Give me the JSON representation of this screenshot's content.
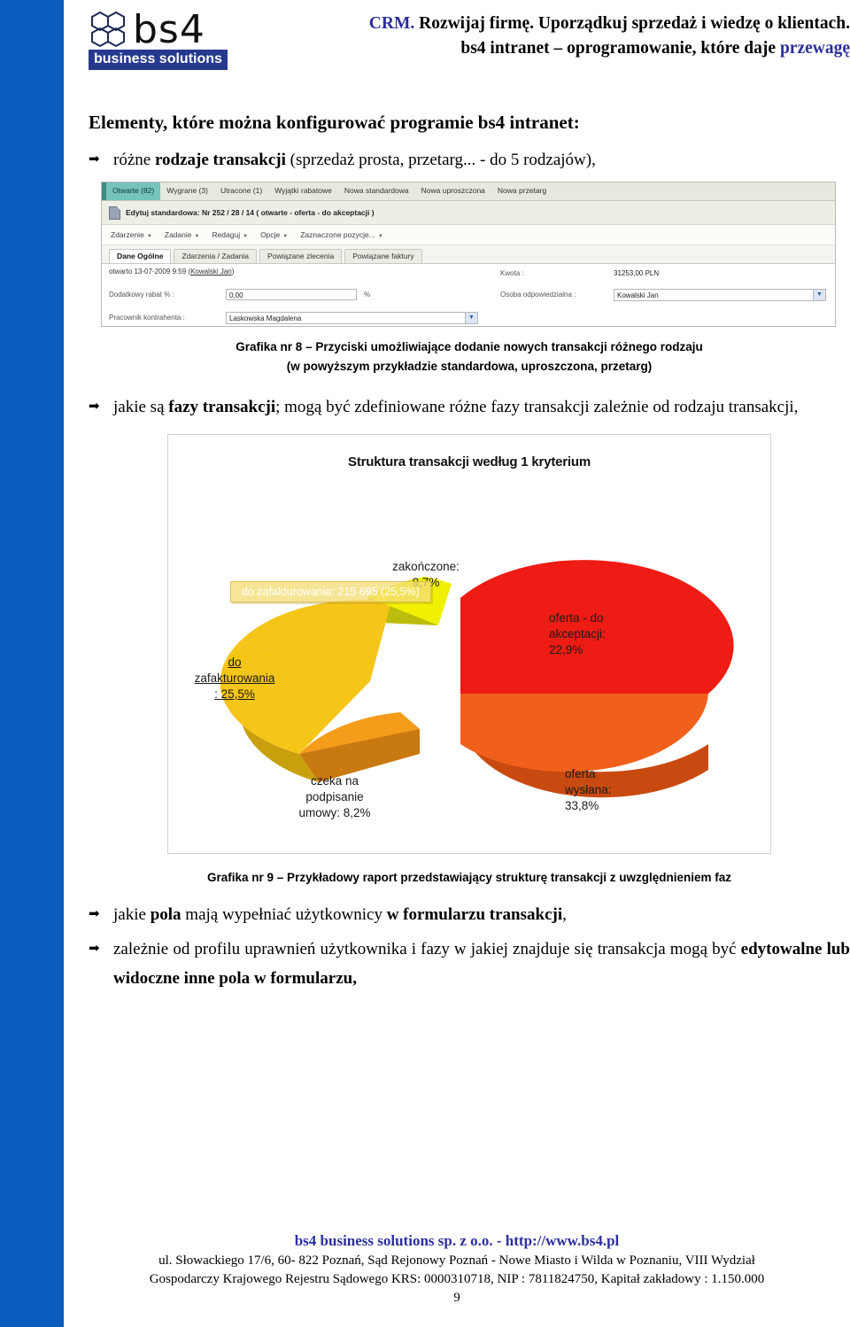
{
  "brand": {
    "logo_word": "bs4",
    "logo_sub": "business solutions",
    "hex_icon": "hexagons-icon"
  },
  "header": {
    "line1_accent": "CRM.",
    "line1_rest": " Rozwijaj firmę. Uporządkuj sprzedaż i wiedzę o klientach.",
    "line2_pre": "bs4 intranet – oprogramowanie, które daje ",
    "line2_accent": "przewagę"
  },
  "section": {
    "title": "Elementy, które można konfigurować programie bs4 intranet:"
  },
  "bullets": {
    "b1_pre": "różne ",
    "b1_bold": "rodzaje transakcji",
    "b1_post": " (sprzedaż prosta, przetarg... - do 5 rodzajów),",
    "b2_pre": "jakie są ",
    "b2_bold": "fazy transakcji",
    "b2_post": "; mogą być zdefiniowane różne fazy transakcji zależnie od rodzaju transakcji,",
    "b3_pre": "jakie ",
    "b3_bold1": "pola",
    "b3_mid": " mają wypełniać użytkownicy ",
    "b3_bold2": "w formularzu transakcji",
    "b3_post": ",",
    "b4_pre": "zależnie od profilu uprawnień użytkownika i fazy w jakiej znajduje się transakcja mogą być ",
    "b4_bold": "edytowalne lub widoczne inne pola w formularzu,"
  },
  "app": {
    "tabs": [
      {
        "label": "Otwarte (82)",
        "active": true
      },
      {
        "label": "Wygrane (3)",
        "active": false
      },
      {
        "label": "Utracone (1)",
        "active": false
      },
      {
        "label": "Wyjątki rabatowe",
        "active": false
      },
      {
        "label": "Nowa standardowa",
        "active": false
      },
      {
        "label": "Nowa uproszczona",
        "active": false
      },
      {
        "label": "Nowa przetarg",
        "active": false
      }
    ],
    "edit_row": "Edytuj standardowa: Nr 252 / 28 / 14 ( otwarte - oferta - do akceptacji )",
    "menu": [
      "Zdarzenie",
      "Zadanie",
      "Redaguj",
      "Opcje",
      "Zaznaczone pozycje..."
    ],
    "subtabs": [
      {
        "label": "Dane Ogólne",
        "active": true
      },
      {
        "label": "Zdarzenia / Zadania",
        "active": false
      },
      {
        "label": "Powiązane zlecenia",
        "active": false
      },
      {
        "label": "Powiązane faktury",
        "active": false
      }
    ],
    "meta_pre": "otwarto 13-07-2009 9:59 (",
    "meta_user": "Kowalski Jan",
    "meta_post": ")",
    "fields": {
      "rabat_label": "Dodatkowy rabat % :",
      "rabat_value": "0,00",
      "rabat_unit": "%",
      "pracownik_label": "Pracownik kontrahenta :",
      "pracownik_value": "Laskowska Magdalena",
      "kwota_label": "Kwota :",
      "kwota_value": "31253,00 PLN",
      "osoba_label": "Osoba odpowiedzialna :",
      "osoba_value": "Kowalski Jan"
    }
  },
  "caption8": {
    "line1": "Grafika nr 8 – Przyciski umożliwiające dodanie nowych transakcji różnego rodzaju",
    "line2": "(w powyższym przykładzie standardowa, uproszczona, przetarg)"
  },
  "caption9": {
    "line1": "Grafika nr 9 – Przykładowy raport przedstawiający strukturę transakcji z uwzględnieniem faz"
  },
  "chart_data": {
    "type": "pie",
    "title": "Struktura transakcji według 1 kryterium",
    "legend_position": "callout-labels",
    "categories": [
      "oferta - do akceptacji",
      "oferta wysłana",
      "czeka na podpisanie umowy",
      "do zafakturowania",
      "zakończone"
    ],
    "values": [
      22.9,
      33.8,
      8.2,
      25.5,
      9.7
    ],
    "value_unit": "%",
    "labels": [
      "oferta - do akceptacji: 22,9%",
      "oferta wysłana: 33,8%",
      "czeka na podpisanie umowy: 8,2%",
      "do zafakturowania : 25,5%",
      "zakończone: 9,7%"
    ],
    "label_lines": {
      "acceptance": [
        "oferta - do",
        "akceptacji:",
        "22,9%"
      ],
      "sent": [
        "oferta",
        "wysłana:",
        "33,8%"
      ],
      "signing": [
        "czeka na",
        "podpisanie",
        "umowy: 8,2%"
      ],
      "invoicing": [
        "do",
        "zafakturowania",
        ": 25,5%"
      ],
      "finished": [
        "zakończone:",
        "9,7%"
      ]
    },
    "colors": [
      "#EE1C14",
      "#F0601B",
      "#F59C1A",
      "#F5C518",
      "#F0F000"
    ],
    "tooltip": "do zafakturowania:   215 695 (25,5%)",
    "tooltip_series": "do zafakturowania",
    "tooltip_value": "215 695",
    "tooltip_pct": "25,5%"
  },
  "footer": {
    "company": "bs4 business solutions sp. z o.o. - http://www.bs4.pl",
    "addr1": "ul. Słowackiego 17/6, 60- 822 Poznań, Sąd Rejonowy Poznań - Nowe Miasto i Wilda w Poznaniu, VIII Wydział",
    "addr2": "Gospodarczy Krajowego Rejestru Sądowego KRS: 0000310718, NIP : 7811824750, Kapitał zakładowy : 1.150.000",
    "page": "9"
  },
  "colors": {
    "left_bar": "#0B5EC0",
    "accent_blue": "#2B2F9E",
    "logo_badge": "#253A8E"
  }
}
